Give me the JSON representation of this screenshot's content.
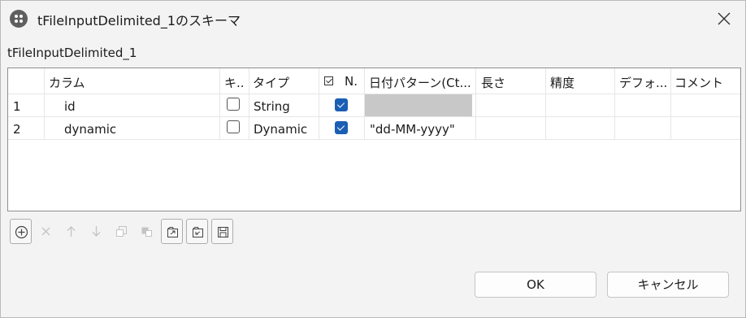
{
  "window": {
    "title": "tFileInputDelimited_1のスキーマ"
  },
  "subtitle": "tFileInputDelimited_1",
  "table": {
    "headers": {
      "column": "カラム",
      "key": "キ..",
      "type": "タイプ",
      "nullable": "N.",
      "date_pattern": "日付パターン(Ct...",
      "length": "長さ",
      "precision": "精度",
      "default": "デフォ...",
      "comment": "コメント"
    },
    "rows": [
      {
        "num": "1",
        "column": "id",
        "key": false,
        "type": "String",
        "nullable": true,
        "date_pattern": ""
      },
      {
        "num": "2",
        "column": "dynamic",
        "key": false,
        "type": "Dynamic",
        "nullable": true,
        "date_pattern": "\"dd-MM-yyyy\""
      }
    ]
  },
  "toolbar": {
    "buttons": [
      {
        "icon": "add-icon",
        "enabled": true
      },
      {
        "icon": "remove-icon",
        "enabled": false
      },
      {
        "icon": "move-up-icon",
        "enabled": false
      },
      {
        "icon": "move-down-icon",
        "enabled": false
      },
      {
        "icon": "copy-icon",
        "enabled": false
      },
      {
        "icon": "paste-icon",
        "enabled": false
      },
      {
        "icon": "import-icon",
        "enabled": true
      },
      {
        "icon": "export-icon",
        "enabled": true
      },
      {
        "icon": "save-icon",
        "enabled": true
      }
    ]
  },
  "buttons": {
    "ok": "OK",
    "cancel": "キャンセル"
  }
}
